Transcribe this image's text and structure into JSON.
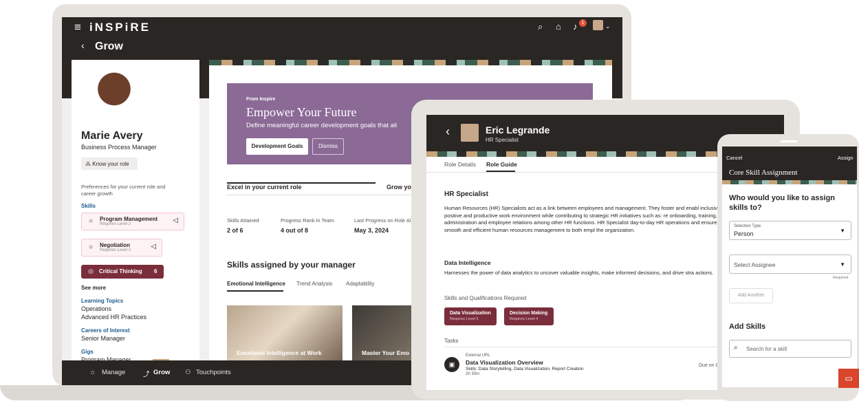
{
  "laptop": {
    "brand": "iNSPiRE",
    "page_title": "Grow",
    "notification_count": "1",
    "profile": {
      "name": "Marie Avery",
      "role": "Business Process Manager",
      "know_role": "Know your role",
      "preferences": "Preferences for your current role and career growth",
      "skills_label": "Skills",
      "skills": [
        {
          "name": "Program Management",
          "level": "Requires Level 2"
        },
        {
          "name": "Negotiation",
          "level": "Requires Level 2"
        }
      ],
      "critical_thinking": {
        "name": "Critical Thinking",
        "count": "6"
      },
      "see_more": "See more",
      "learning_topics_label": "Learning Topics",
      "learning_topics": [
        "Operations",
        "Advanced HR Practices"
      ],
      "careers_label": "Careers of Interest",
      "career": "Senior Manager",
      "gigs_label": "Gigs",
      "gig": "Program Manager"
    },
    "hero": {
      "from": "From Inspire",
      "title": "Empower Your Future",
      "desc": "Define meaningful career development goals that ali",
      "primary_btn": "Development Goals",
      "secondary_btn": "Dismiss"
    },
    "tabs": [
      "Excel in your current role",
      "Grow you"
    ],
    "stats": [
      {
        "label": "Skills Attained",
        "value": "2 of 6"
      },
      {
        "label": "Progress Rank in Team",
        "value": "4 out of 8"
      },
      {
        "label": "Last Progress on Role Al",
        "value": "May 3, 2024"
      }
    ],
    "assigned_title": "Skills assigned by your manager",
    "subtabs": [
      "Emotional Intelligence",
      "Trend Analysis",
      "Adaptability"
    ],
    "cards": [
      "Emotional Intelligence at Work",
      "Master Your Emo"
    ],
    "bottom_nav": [
      "Manage",
      "Grow",
      "Touchpoints"
    ]
  },
  "tablet": {
    "name": "Eric Legrande",
    "role": "HR Specialist",
    "tabs": [
      "Role Details",
      "Role Guide"
    ],
    "section_title": "HR Specialist",
    "section_body": "Human Resources (HR) Specialists act as a link between employees and management. They foster and enabl inclusive, positive and productive work environment while contributing to strategic HR initiatives such as: re onboarding, training, policy administration and employee relations among other HR functions. HR Specialist day-to-day HR operations and ensure an smooth and efficient human resources management to both empl the organization.",
    "di_title": "Data Intelligence",
    "di_body": "Harnesses the power of data analytics to uncover valuable insights, make informed decisions, and drive stra actions.",
    "sq_label": "Skills and Qualifications Required",
    "chips": [
      {
        "name": "Data Visualization",
        "level": "Requires Level 3"
      },
      {
        "name": "Decision Making",
        "level": "Requires Level 4"
      }
    ],
    "tasks_label": "Tasks",
    "task": {
      "type": "External URL",
      "title": "Data Visualization Overview",
      "skills": "Skills: Data Storytelling, Data Visualization, Report Creation",
      "duration": "2h 30m",
      "due": "Due on C"
    }
  },
  "phone": {
    "cancel": "Cancel",
    "assign": "Assign",
    "title": "Core Skill Assignment",
    "question": "Who would you like to assign skills to?",
    "selection_label": "Selection Type",
    "selection_value": "Person",
    "assignee_placeholder": "Select Assignee",
    "required": "Required",
    "add_another": "Add Another",
    "add_skills": "Add Skills",
    "search_placeholder": "Search for a skill"
  }
}
